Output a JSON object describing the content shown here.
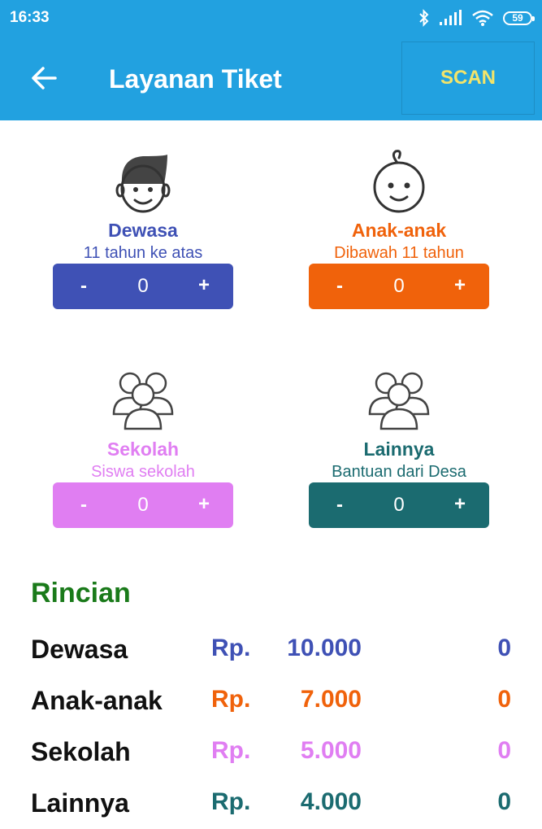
{
  "status": {
    "time": "16:33",
    "battery": "59"
  },
  "appbar": {
    "title": "Layanan Tiket",
    "scan_label": "SCAN"
  },
  "colors": {
    "appbar": "#22a1e0",
    "dewasa": "#3f51b5",
    "anak": "#f0620b",
    "sekolah": "#e07ef2",
    "lainnya": "#1b6b70",
    "rincian_title": "#1a7a1a"
  },
  "tickets": [
    {
      "name": "Dewasa",
      "subtitle": "11 tahun ke atas",
      "minus": "-",
      "count": "0",
      "plus": "+",
      "icon": "man-icon"
    },
    {
      "name": "Anak-anak",
      "subtitle": "Dibawah 11 tahun",
      "minus": "-",
      "count": "0",
      "plus": "+",
      "icon": "child-icon"
    },
    {
      "name": "Sekolah",
      "subtitle": "Siswa sekolah",
      "minus": "-",
      "count": "0",
      "plus": "+",
      "icon": "group-icon"
    },
    {
      "name": "Lainnya",
      "subtitle": "Bantuan dari Desa",
      "minus": "-",
      "count": "0",
      "plus": "+",
      "icon": "group-icon"
    }
  ],
  "rincian": {
    "title": "Rincian",
    "rows": [
      {
        "label": "Dewasa",
        "currency": "Rp.",
        "price": "10.000",
        "count": "0"
      },
      {
        "label": "Anak-anak",
        "currency": "Rp.",
        "price": "7.000",
        "count": "0"
      },
      {
        "label": "Sekolah",
        "currency": "Rp.",
        "price": "5.000",
        "count": "0"
      },
      {
        "label": "Lainnya",
        "currency": "Rp.",
        "price": "4.000",
        "count": "0"
      }
    ]
  }
}
